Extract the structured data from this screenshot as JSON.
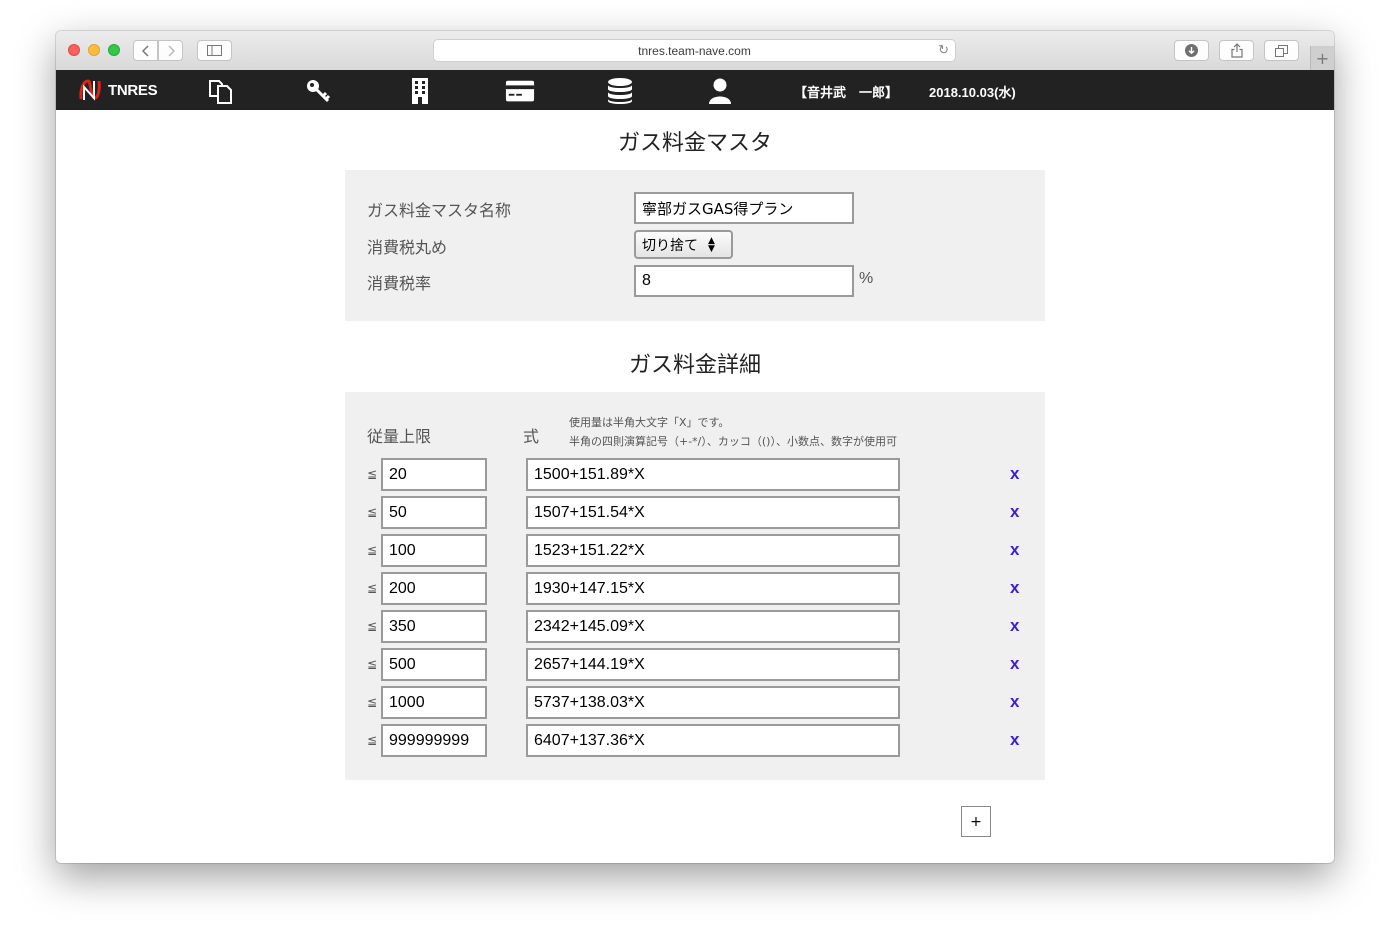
{
  "browser": {
    "url": "tnres.team-nave.com",
    "new_tab_label": "+"
  },
  "nav": {
    "logo_text": "TNRES",
    "icons": [
      "documents-icon",
      "key-icon",
      "building-icon",
      "credit-card-icon",
      "database-icon",
      "user-icon"
    ],
    "user": "【音井武　一郎】",
    "date": "2018.10.03(水)"
  },
  "master": {
    "title": "ガス料金マスタ",
    "name_label": "ガス料金マスタ名称",
    "name_value": "寧部ガスGAS得プラン",
    "rounding_label": "消費税丸め",
    "rounding_value": "切り捨て",
    "rate_label": "消費税率",
    "rate_value": "8",
    "rate_unit": "%"
  },
  "detail": {
    "title": "ガス料金詳細",
    "col_limit": "従量上限",
    "col_formula": "式",
    "note_line1": "使用量は半角大文字「X」です。",
    "note_line2": "半角の四則演算記号（+-*/）、カッコ（()）、小数点、数字が使用可",
    "le_symbol": "≦",
    "delete_label": "x",
    "add_label": "+",
    "rows": [
      {
        "limit": "20",
        "formula": "1500+151.89*X"
      },
      {
        "limit": "50",
        "formula": "1507+151.54*X"
      },
      {
        "limit": "100",
        "formula": "1523+151.22*X"
      },
      {
        "limit": "200",
        "formula": "1930+147.15*X"
      },
      {
        "limit": "350",
        "formula": "2342+145.09*X"
      },
      {
        "limit": "500",
        "formula": "2657+144.19*X"
      },
      {
        "limit": "1000",
        "formula": "5737+138.03*X"
      },
      {
        "limit": "999999999",
        "formula": "6407+137.36*X"
      }
    ]
  }
}
